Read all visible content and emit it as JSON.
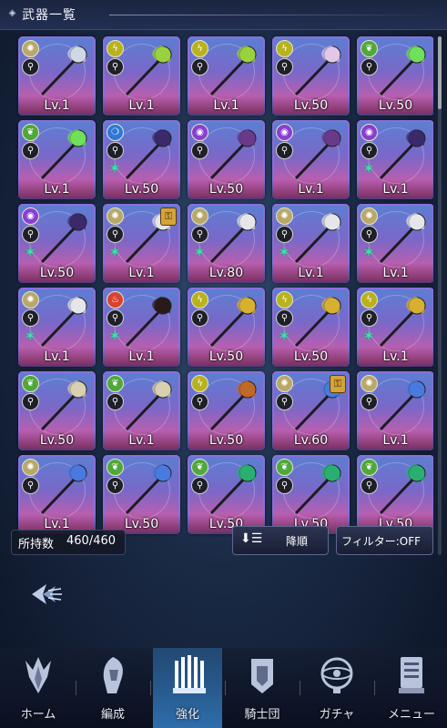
{
  "header": {
    "title": "武器一覧"
  },
  "grid": {
    "cards": [
      {
        "level": "Lv.1",
        "element": "light",
        "element_color": "#b8a86a",
        "type": "wand",
        "star": false,
        "lock": false,
        "weapon_color": "#cfd8e4"
      },
      {
        "level": "Lv.1",
        "element": "thunder",
        "element_color": "#b9b21e",
        "type": "wand",
        "star": false,
        "lock": false,
        "weapon_color": "#9ad13e"
      },
      {
        "level": "Lv.1",
        "element": "thunder",
        "element_color": "#b9b21e",
        "type": "wand",
        "star": false,
        "lock": false,
        "weapon_color": "#9ad13e"
      },
      {
        "level": "Lv.50",
        "element": "thunder",
        "element_color": "#b9b21e",
        "type": "wand",
        "star": false,
        "lock": false,
        "weapon_color": "#e1c8e8"
      },
      {
        "level": "Lv.50",
        "element": "wind",
        "element_color": "#4fa83a",
        "type": "wand",
        "star": false,
        "lock": false,
        "weapon_color": "#6fe05a"
      },
      {
        "level": "Lv.1",
        "element": "wind",
        "element_color": "#4fa83a",
        "type": "wand",
        "star": false,
        "lock": false,
        "weapon_color": "#6fe05a"
      },
      {
        "level": "Lv.50",
        "element": "water",
        "element_color": "#2f78d8",
        "type": "wand",
        "star": true,
        "lock": false,
        "weapon_color": "#3b2a6b"
      },
      {
        "level": "Lv.50",
        "element": "dark",
        "element_color": "#8a3fd0",
        "type": "wand",
        "star": false,
        "lock": false,
        "weapon_color": "#6a3a8a"
      },
      {
        "level": "Lv.1",
        "element": "dark",
        "element_color": "#8a3fd0",
        "type": "wand",
        "star": false,
        "lock": false,
        "weapon_color": "#6a3a8a"
      },
      {
        "level": "Lv.1",
        "element": "dark",
        "element_color": "#8a3fd0",
        "type": "wand",
        "star": true,
        "lock": false,
        "weapon_color": "#3b2a6b"
      },
      {
        "level": "Lv.50",
        "element": "dark",
        "element_color": "#8a3fd0",
        "type": "wand",
        "star": true,
        "lock": false,
        "weapon_color": "#3b2a6b"
      },
      {
        "level": "Lv.1",
        "element": "light",
        "element_color": "#b8a86a",
        "type": "wand",
        "star": true,
        "lock": true,
        "weapon_color": "#e6e6ea"
      },
      {
        "level": "Lv.80",
        "element": "light",
        "element_color": "#b8a86a",
        "type": "wand",
        "star": true,
        "lock": false,
        "weapon_color": "#e6e6ea"
      },
      {
        "level": "Lv.1",
        "element": "light",
        "element_color": "#b8a86a",
        "type": "wand",
        "star": true,
        "lock": false,
        "weapon_color": "#e6e6ea"
      },
      {
        "level": "Lv.1",
        "element": "light",
        "element_color": "#b8a86a",
        "type": "wand",
        "star": true,
        "lock": false,
        "weapon_color": "#e6e6ea"
      },
      {
        "level": "Lv.1",
        "element": "light",
        "element_color": "#b8a86a",
        "type": "wand",
        "star": true,
        "lock": false,
        "weapon_color": "#e6e6ea"
      },
      {
        "level": "Lv.1",
        "element": "fire",
        "element_color": "#d8432f",
        "type": "wand",
        "star": true,
        "lock": false,
        "weapon_color": "#2a1a1a"
      },
      {
        "level": "Lv.50",
        "element": "thunder",
        "element_color": "#b9b21e",
        "type": "wand",
        "star": false,
        "lock": false,
        "weapon_color": "#d8b030"
      },
      {
        "level": "Lv.50",
        "element": "thunder",
        "element_color": "#b9b21e",
        "type": "wand",
        "star": true,
        "lock": false,
        "weapon_color": "#d8b030"
      },
      {
        "level": "Lv.1",
        "element": "thunder",
        "element_color": "#b9b21e",
        "type": "wand",
        "star": true,
        "lock": false,
        "weapon_color": "#d8b030"
      },
      {
        "level": "Lv.50",
        "element": "wind",
        "element_color": "#4fa83a",
        "type": "wand",
        "star": false,
        "lock": false,
        "weapon_color": "#d9d0b0"
      },
      {
        "level": "Lv.1",
        "element": "wind",
        "element_color": "#4fa83a",
        "type": "wand",
        "star": false,
        "lock": false,
        "weapon_color": "#d9d0b0"
      },
      {
        "level": "Lv.50",
        "element": "thunder",
        "element_color": "#b9b21e",
        "type": "wand",
        "star": false,
        "lock": false,
        "weapon_color": "#c06a2a"
      },
      {
        "level": "Lv.60",
        "element": "light",
        "element_color": "#b8a86a",
        "type": "wand",
        "star": false,
        "lock": true,
        "weapon_color": "#4a7ae0"
      },
      {
        "level": "Lv.1",
        "element": "light",
        "element_color": "#b8a86a",
        "type": "wand",
        "star": false,
        "lock": false,
        "weapon_color": "#4a7ae0"
      },
      {
        "level": "Lv.1",
        "element": "light",
        "element_color": "#b8a86a",
        "type": "wand",
        "star": false,
        "lock": false,
        "weapon_color": "#4a7ae0"
      },
      {
        "level": "Lv.50",
        "element": "wind",
        "element_color": "#4fa83a",
        "type": "wand",
        "star": false,
        "lock": false,
        "weapon_color": "#4a7ae0"
      },
      {
        "level": "Lv.50",
        "element": "wind",
        "element_color": "#4fa83a",
        "type": "wand",
        "star": false,
        "lock": false,
        "weapon_color": "#2ab070"
      },
      {
        "level": "Lv.50",
        "element": "wind",
        "element_color": "#4fa83a",
        "type": "wand",
        "star": false,
        "lock": false,
        "weapon_color": "#2ab070"
      },
      {
        "level": "Lv.50",
        "element": "wind",
        "element_color": "#4fa83a",
        "type": "wand",
        "star": false,
        "lock": false,
        "weapon_color": "#2ab070"
      }
    ]
  },
  "footer": {
    "owned_label": "所持数",
    "owned_count": "460/460",
    "sort_label": "降順",
    "sort_icon": "sort-descending-icon",
    "filter_label": "フィルター:OFF"
  },
  "nav": {
    "items": [
      {
        "label": "ホーム",
        "icon": "home-helm-icon",
        "active": false
      },
      {
        "label": "編成",
        "icon": "formation-knight-icon",
        "active": false
      },
      {
        "label": "強化",
        "icon": "upgrade-weapons-icon",
        "active": true
      },
      {
        "label": "騎士団",
        "icon": "knights-banner-icon",
        "active": false
      },
      {
        "label": "ガチャ",
        "icon": "gacha-armillary-icon",
        "active": false
      },
      {
        "label": "メニュー",
        "icon": "menu-book-icon",
        "active": false
      }
    ]
  },
  "colors": {
    "accent": "#3c96e6",
    "card_border": "#8a6fd9",
    "star": "#3fe0b0"
  }
}
